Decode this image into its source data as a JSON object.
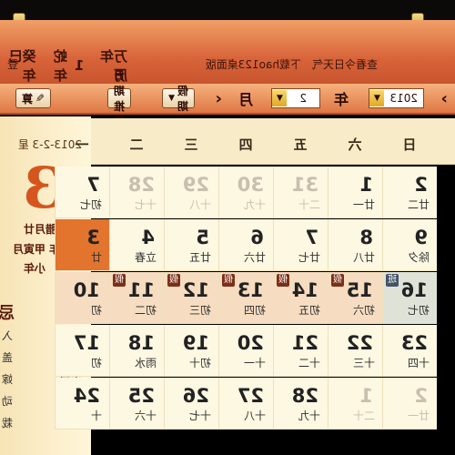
{
  "header": {
    "title_parts": [
      "万年历",
      "1",
      "蛇年",
      "癸巳年"
    ],
    "links": [
      "查看今日天气",
      "下载hao123桌面版",
      "登"
    ]
  },
  "toolbar": {
    "year_value": "2013",
    "year_label": "年",
    "month_value": "2",
    "month_label": "月",
    "holiday_label": "假期",
    "date_lookup_label": "日期推算",
    "calc_label": "算",
    "left_arrow": "‹",
    "right_arrow": "›"
  },
  "left_panel": {
    "date_line": "2013-2-3 星",
    "big_day": "3",
    "lunar_lines": [
      "农历 腊月廿",
      "癸巳年 甲寅月",
      "小年"
    ],
    "yi_label": "宜",
    "ji_label": "忌",
    "yi_items": [
      "祭祀",
      "祈福",
      "求嗣",
      "沐浴",
      "问名"
    ],
    "ji_items": [
      "入",
      "盖",
      "嫁",
      "动",
      "栽"
    ]
  },
  "calendar": {
    "weekdays": [
      "一",
      "二",
      "三",
      "四",
      "五",
      "六",
      "日"
    ],
    "rows": [
      [
        {
          "d": "7",
          "s": "初七"
        },
        {
          "d": "28",
          "s": "十七",
          "o": true
        },
        {
          "d": "29",
          "s": "十八",
          "o": true
        },
        {
          "d": "30",
          "s": "十九",
          "o": true
        },
        {
          "d": "31",
          "s": "二十",
          "o": true
        },
        {
          "d": "1",
          "s": "廿一"
        },
        {
          "d": "2",
          "s": "廿二"
        }
      ],
      [
        {
          "d": "3",
          "s": "廿",
          "hl": true
        },
        {
          "d": "4",
          "s": "立春"
        },
        {
          "d": "5",
          "s": "廿五"
        },
        {
          "d": "6",
          "s": "廿六"
        },
        {
          "d": "7",
          "s": "廿七"
        },
        {
          "d": "8",
          "s": "廿八"
        },
        {
          "d": "9",
          "s": "除夕"
        }
      ],
      [
        {
          "d": "10",
          "s": "初"
        },
        {
          "d": "11",
          "s": "初二",
          "b": "假"
        },
        {
          "d": "12",
          "s": "初三",
          "b": "假"
        },
        {
          "d": "13",
          "s": "初四",
          "b": "假"
        },
        {
          "d": "14",
          "s": "初五",
          "b": "假"
        },
        {
          "d": "15",
          "s": "初六",
          "b": "假"
        },
        {
          "d": "16",
          "s": "初七",
          "b": "班",
          "today": true
        }
      ],
      [
        {
          "d": "17",
          "s": "初"
        },
        {
          "d": "18",
          "s": "雨水"
        },
        {
          "d": "19",
          "s": "初十"
        },
        {
          "d": "20",
          "s": "十一"
        },
        {
          "d": "21",
          "s": "十二"
        },
        {
          "d": "22",
          "s": "十三"
        },
        {
          "d": "23",
          "s": "十四"
        }
      ],
      [
        {
          "d": "24",
          "s": "十"
        },
        {
          "d": "25",
          "s": "十六"
        },
        {
          "d": "26",
          "s": "十七"
        },
        {
          "d": "27",
          "s": "十八"
        },
        {
          "d": "28",
          "s": "十九"
        },
        {
          "d": "1",
          "s": "二十",
          "o": true
        },
        {
          "d": "2",
          "s": "廿一",
          "o": true
        }
      ]
    ]
  },
  "colors": {
    "accent": "#d9643a",
    "highlight": "#e2742e",
    "holiday_badge": "#7d2f18"
  }
}
